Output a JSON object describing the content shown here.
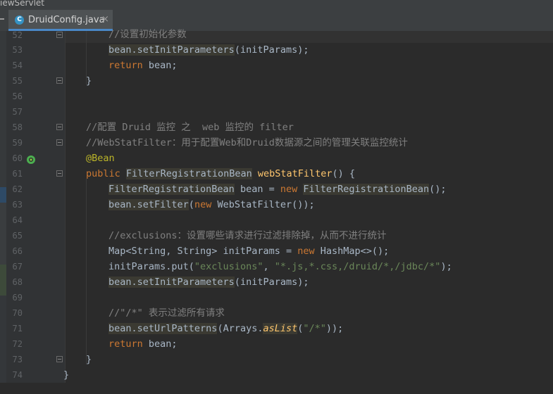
{
  "top_title": "iewServlet",
  "tab": {
    "icon_letter": "C",
    "label": "DruidConfig.java",
    "close": "×"
  },
  "line_numbers": [
    "52",
    "53",
    "54",
    "55",
    "56",
    "57",
    "58",
    "59",
    "60",
    "61",
    "62",
    "63",
    "64",
    "65",
    "66",
    "67",
    "68",
    "69",
    "70",
    "71",
    "72",
    "73",
    "74"
  ],
  "code": {
    "l52": "//设置初始化参数",
    "l53_a": "bean.setInitParameters",
    "l53_b": "(initParams);",
    "l54_a": "return",
    "l54_b": " bean;",
    "l55": "}",
    "l58": "//配置 Druid 监控 之  web 监控的 filter",
    "l59": "//WebStatFilter：用于配置Web和Druid数据源之间的管理关联监控统计",
    "l60": "@Bean",
    "l61_a": "public ",
    "l61_b": "FilterRegistrationBean",
    "l61_c": " ",
    "l61_d": "webStatFilter",
    "l61_e": "() {",
    "l62_a": "FilterRegistrationBean",
    "l62_b": " bean = ",
    "l62_c": "new ",
    "l62_d": "FilterRegistrationBean",
    "l62_e": "();",
    "l63_a": "bean.setFilter",
    "l63_b": "(",
    "l63_c": "new ",
    "l63_d": "WebStatFilter());",
    "l65": "//exclusions：设置哪些请求进行过滤排除掉，从而不进行统计",
    "l66_a": "Map<String, String> initParams = ",
    "l66_b": "new ",
    "l66_c": "HashMap<>();",
    "l67_a": "initParams.put(",
    "l67_b": "\"exclusions\"",
    "l67_c": ", ",
    "l67_d": "\"*.js,*.css,/druid/*,/jdbc/*\"",
    "l67_e": ");",
    "l68_a": "bean.setInitParameters",
    "l68_b": "(initParams);",
    "l70": "//\"/*\" 表示过滤所有请求",
    "l71_a": "bean.setUrlPatterns",
    "l71_b": "(Arrays.",
    "l71_c": "asList",
    "l71_d": "(",
    "l71_e": "\"/*\"",
    "l71_f": "));",
    "l72_a": "return",
    "l72_b": " bean;",
    "l73": "}",
    "l74": "}"
  },
  "colors": {
    "keyword": "#cc7832",
    "comment": "#808080",
    "annotation": "#bbb529",
    "method": "#ffc66d",
    "string": "#6a8759",
    "text": "#a9b7c6",
    "background": "#2b2b2b"
  }
}
